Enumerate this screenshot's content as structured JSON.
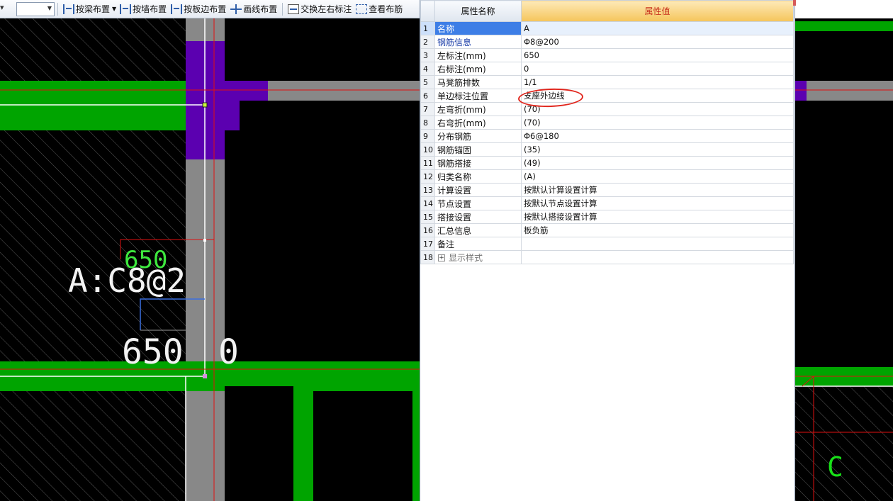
{
  "toolbar": {
    "lead_arrow": "▾",
    "combo_value": "",
    "buttons": [
      {
        "label": "按梁布置",
        "icon": "beam-layout-icon"
      },
      {
        "label": "按墙布置",
        "icon": "wall-layout-icon"
      },
      {
        "label": "按板边布置",
        "icon": "slab-edge-layout-icon"
      },
      {
        "label": "画线布置",
        "icon": "draw-line-icon"
      },
      {
        "label": "交换左右标注",
        "icon": "swap-labels-icon"
      },
      {
        "label": "查看布筋",
        "icon": "view-rebar-icon"
      }
    ]
  },
  "property_panel": {
    "header": {
      "num": "",
      "name": "属性名称",
      "value": "属性值"
    },
    "rows": [
      {
        "num": "1",
        "name": "名称",
        "value": "A",
        "selected": true
      },
      {
        "num": "2",
        "name": "钢筋信息",
        "value": "Φ8@200",
        "blue": true
      },
      {
        "num": "3",
        "name": "左标注(mm)",
        "value": "650"
      },
      {
        "num": "4",
        "name": "右标注(mm)",
        "value": "0"
      },
      {
        "num": "5",
        "name": "马凳筋排数",
        "value": "1/1"
      },
      {
        "num": "6",
        "name": "单边标注位置",
        "value": "支座外边线"
      },
      {
        "num": "7",
        "name": "左弯折(mm)",
        "value": "(70)"
      },
      {
        "num": "8",
        "name": "右弯折(mm)",
        "value": "(70)"
      },
      {
        "num": "9",
        "name": "分布钢筋",
        "value": "Φ6@180"
      },
      {
        "num": "10",
        "name": "钢筋锚固",
        "value": "(35)"
      },
      {
        "num": "11",
        "name": "钢筋搭接",
        "value": "(49)"
      },
      {
        "num": "12",
        "name": "归类名称",
        "value": "(A)"
      },
      {
        "num": "13",
        "name": "计算设置",
        "value": "按默认计算设置计算"
      },
      {
        "num": "14",
        "name": "节点设置",
        "value": "按默认节点设置计算"
      },
      {
        "num": "15",
        "name": "搭接设置",
        "value": "按默认搭接设置计算"
      },
      {
        "num": "16",
        "name": "汇总信息",
        "value": "板负筋"
      },
      {
        "num": "17",
        "name": "备注",
        "value": ""
      },
      {
        "num": "18",
        "name": "显示样式",
        "value": "",
        "expandable": true
      }
    ]
  },
  "canvas": {
    "label_green_650": "650",
    "label_rebar": "A:C8@2",
    "label_white_650": "650",
    "label_zero": "0",
    "label_c": "C"
  },
  "colors": {
    "wall_green": "#00a400",
    "column_purple": "#5b00b0",
    "beam_gray": "#888888",
    "axis_red": "#e01010",
    "hatch_gray": "#5a5a5a"
  }
}
